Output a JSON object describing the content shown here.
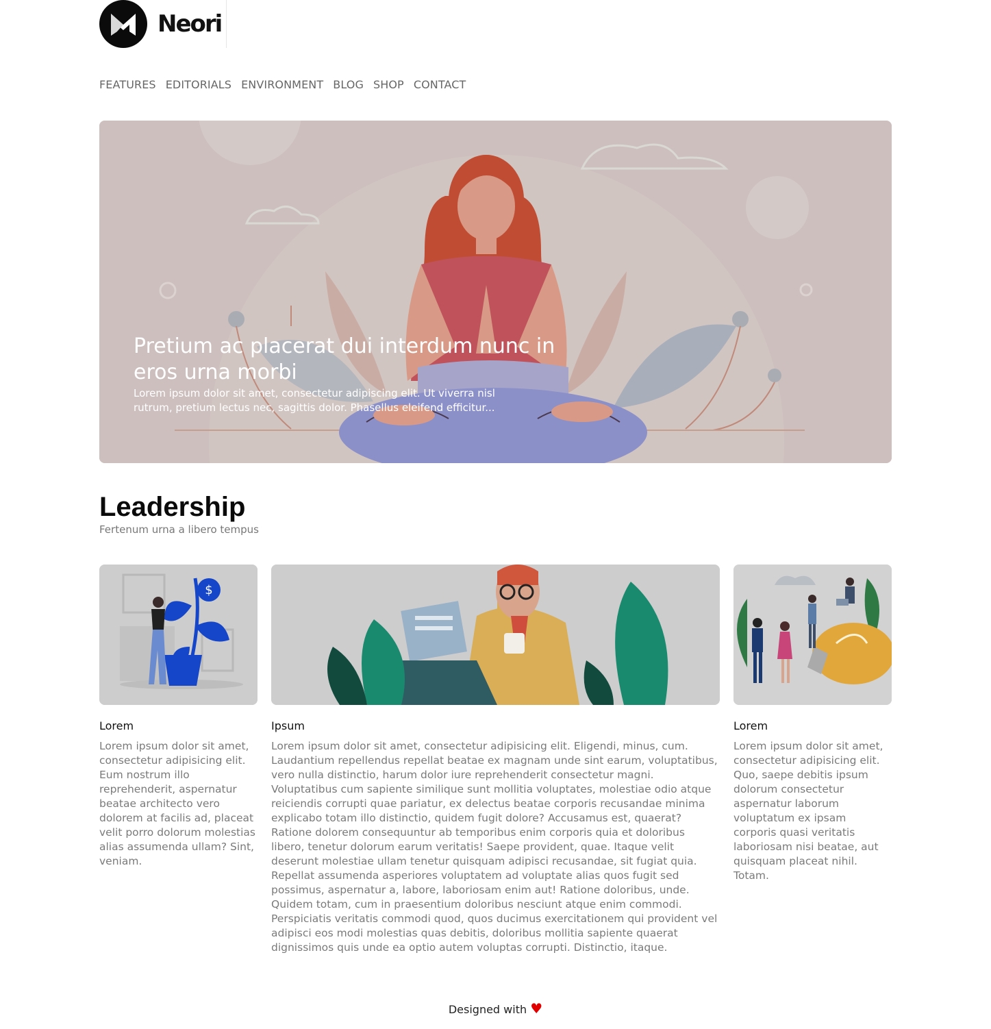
{
  "brand": {
    "name": "Neori",
    "logo_icon": "neori-logo-icon"
  },
  "nav": {
    "items": [
      "FEATURES",
      "EDITORIALS",
      "ENVIRONMENT",
      "BLOG",
      "SHOP",
      "CONTACT"
    ]
  },
  "hero": {
    "title": "Pretium ac placerat dui interdum nunc in eros urna morbi",
    "description": "Lorem ipsum dolor sit amet, consectetur adipiscing elit. Ut viverra nisl rutrum, pretium lectus nec, sagittis dolor. Phasellus eleifend efficitur...",
    "image": "meditating-woman-illustration"
  },
  "section": {
    "title": "Leadership",
    "subtitle": "Fertenum urna a libero tempus"
  },
  "cards": [
    {
      "title": "Lorem",
      "image": "woman-watering-money-plant-illustration",
      "text": "Lorem ipsum dolor sit amet, consectetur adipisicing elit. Eum nostrum illo reprehenderit, aspernatur beatae architecto vero dolorem at facilis ad, placeat velit porro dolorum molestias alias assumenda ullam? Sint, veniam."
    },
    {
      "title": "Ipsum",
      "image": "man-drinking-coffee-laptop-illustration",
      "text": "Lorem ipsum dolor sit amet, consectetur adipisicing elit. Eligendi, minus, cum. Laudantium repellendus repellat beatae ex magnam unde sint earum, voluptatibus, vero nulla distinctio, harum dolor iure reprehenderit consectetur magni. Voluptatibus cum sapiente similique sunt mollitia voluptates, molestiae odio atque reiciendis corrupti quae pariatur, ex delectus beatae corporis recusandae minima explicabo totam illo distinctio, quidem fugit dolore? Accusamus est, quaerat? Ratione dolorem consequuntur ab temporibus enim corporis quia et doloribus libero, tenetur dolorum earum veritatis! Saepe provident, quae. Itaque velit deserunt molestiae ullam tenetur quisquam adipisci recusandae, sit fugiat quia. Repellat assumenda asperiores voluptatem ad voluptate alias quos fugit sed possimus, aspernatur a, labore, laboriosam enim aut! Ratione doloribus, unde. Quidem totam, cum in praesentium doloribus nesciunt atque enim commodi. Perspiciatis veritatis commodi quod, quos ducimus exercitationem qui provident vel adipisci eos modi molestias quas debitis, doloribus mollitia sapiente quaerat dignissimos quis unde ea optio autem voluptas corrupti. Distinctio, itaque."
    },
    {
      "title": "Lorem",
      "image": "team-lightbulb-idea-illustration",
      "text": "Lorem ipsum dolor sit amet, consectetur adipisicing elit. Quo, saepe debitis ipsum dolorum consectetur aspernatur laborum voluptatum ex ipsam corporis quasi veritatis laboriosam nisi beatae, aut quisquam placeat nihil. Totam."
    }
  ],
  "footer": {
    "text": "Designed with",
    "icon": "heart-icon",
    "heart_color": "#e00000"
  }
}
